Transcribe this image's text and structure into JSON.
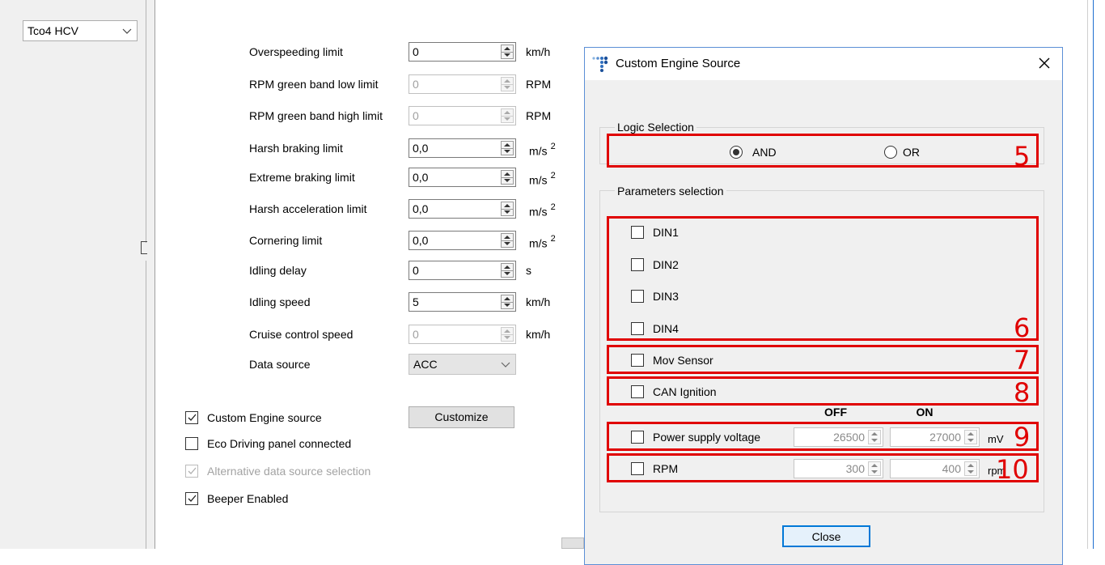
{
  "left_panel": {
    "device_select": "Tco4 HCV"
  },
  "form": {
    "rows": [
      {
        "label": "Overspeeding limit",
        "value": "0",
        "unit": "km/h",
        "sup": "",
        "enabled": true
      },
      {
        "label": "RPM green band low limit",
        "value": "0",
        "unit": "RPM",
        "sup": "",
        "enabled": false
      },
      {
        "label": "RPM green band high limit",
        "value": "0",
        "unit": "RPM",
        "sup": "",
        "enabled": false
      },
      {
        "label": "Harsh braking limit",
        "value": "0,0",
        "unit": "m/s",
        "sup": "2",
        "enabled": true
      },
      {
        "label": "Extreme braking limit",
        "value": "0,0",
        "unit": "m/s",
        "sup": "2",
        "enabled": true
      },
      {
        "label": "Harsh acceleration limit",
        "value": "0,0",
        "unit": "m/s",
        "sup": "2",
        "enabled": true
      },
      {
        "label": "Cornering limit",
        "value": "0,0",
        "unit": "m/s",
        "sup": "2",
        "enabled": true
      },
      {
        "label": "Idling delay",
        "value": "0",
        "unit": "s",
        "sup": "",
        "enabled": true
      },
      {
        "label": "Idling speed",
        "value": "5",
        "unit": "km/h",
        "sup": "",
        "enabled": true
      },
      {
        "label": "Cruise control speed",
        "value": "0",
        "unit": "km/h",
        "sup": "",
        "enabled": false
      }
    ],
    "data_source_label": "Data source",
    "data_source_value": "ACC",
    "checkboxes": [
      {
        "label": "Custom Engine source",
        "checked": true,
        "enabled": true
      },
      {
        "label": "Eco Driving panel connected",
        "checked": false,
        "enabled": true
      },
      {
        "label": "Alternative data source selection",
        "checked": true,
        "enabled": false
      },
      {
        "label": "Beeper Enabled",
        "checked": true,
        "enabled": true
      }
    ],
    "customize_button": "Customize"
  },
  "dialog": {
    "title": "Custom Engine Source",
    "logic_group_title": "Logic Selection",
    "logic_options": [
      {
        "label": "AND",
        "selected": true
      },
      {
        "label": "OR",
        "selected": false
      }
    ],
    "params_group_title": "Parameters selection",
    "din_items": [
      "DIN1",
      "DIN2",
      "DIN3",
      "DIN4"
    ],
    "mov_sensor": "Mov Sensor",
    "can_ignition": "CAN Ignition",
    "off_header": "OFF",
    "on_header": "ON",
    "power_supply": {
      "label": "Power supply voltage",
      "off": "26500",
      "on": "27000",
      "unit": "mV"
    },
    "rpm": {
      "label": "RPM",
      "off": "300",
      "on": "400",
      "unit": "rpm"
    },
    "close_button": "Close",
    "annotations": [
      "5",
      "6",
      "7",
      "8",
      "9",
      "10"
    ]
  }
}
